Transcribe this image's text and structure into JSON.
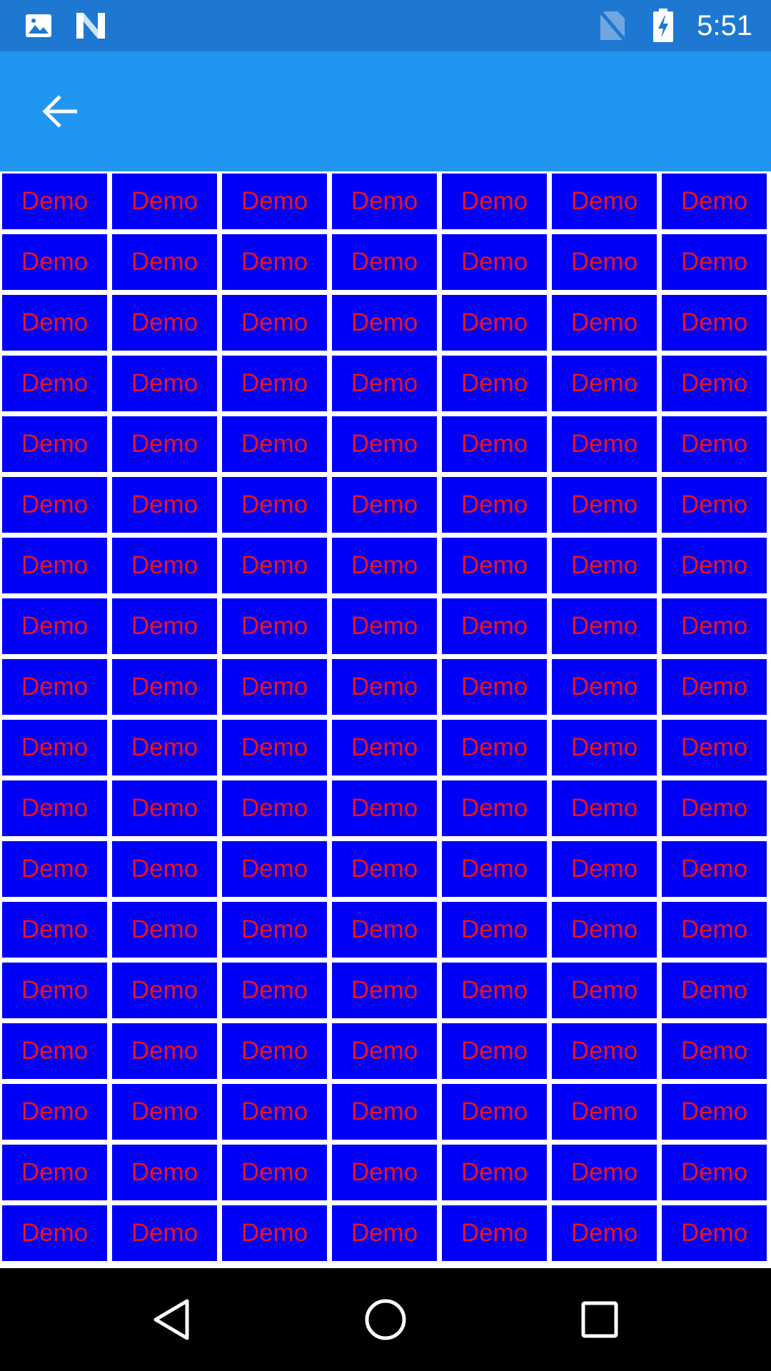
{
  "status_bar": {
    "time": "5:51",
    "icons": [
      "image-notification-icon",
      "n-notification-icon",
      "no-sim-icon",
      "battery-charging-icon"
    ],
    "background_color": "#1e78d2"
  },
  "app_bar": {
    "back_icon": "arrow-back-icon",
    "background_color": "#2196f0"
  },
  "grid": {
    "columns": 7,
    "rows": 18,
    "cell_label": "Demo",
    "cell_background_color": "#0000f7",
    "cell_text_color": "#e8141c"
  },
  "nav_bar": {
    "buttons": [
      "back-triangle-icon",
      "home-circle-icon",
      "recents-square-icon"
    ],
    "background_color": "#000000"
  }
}
